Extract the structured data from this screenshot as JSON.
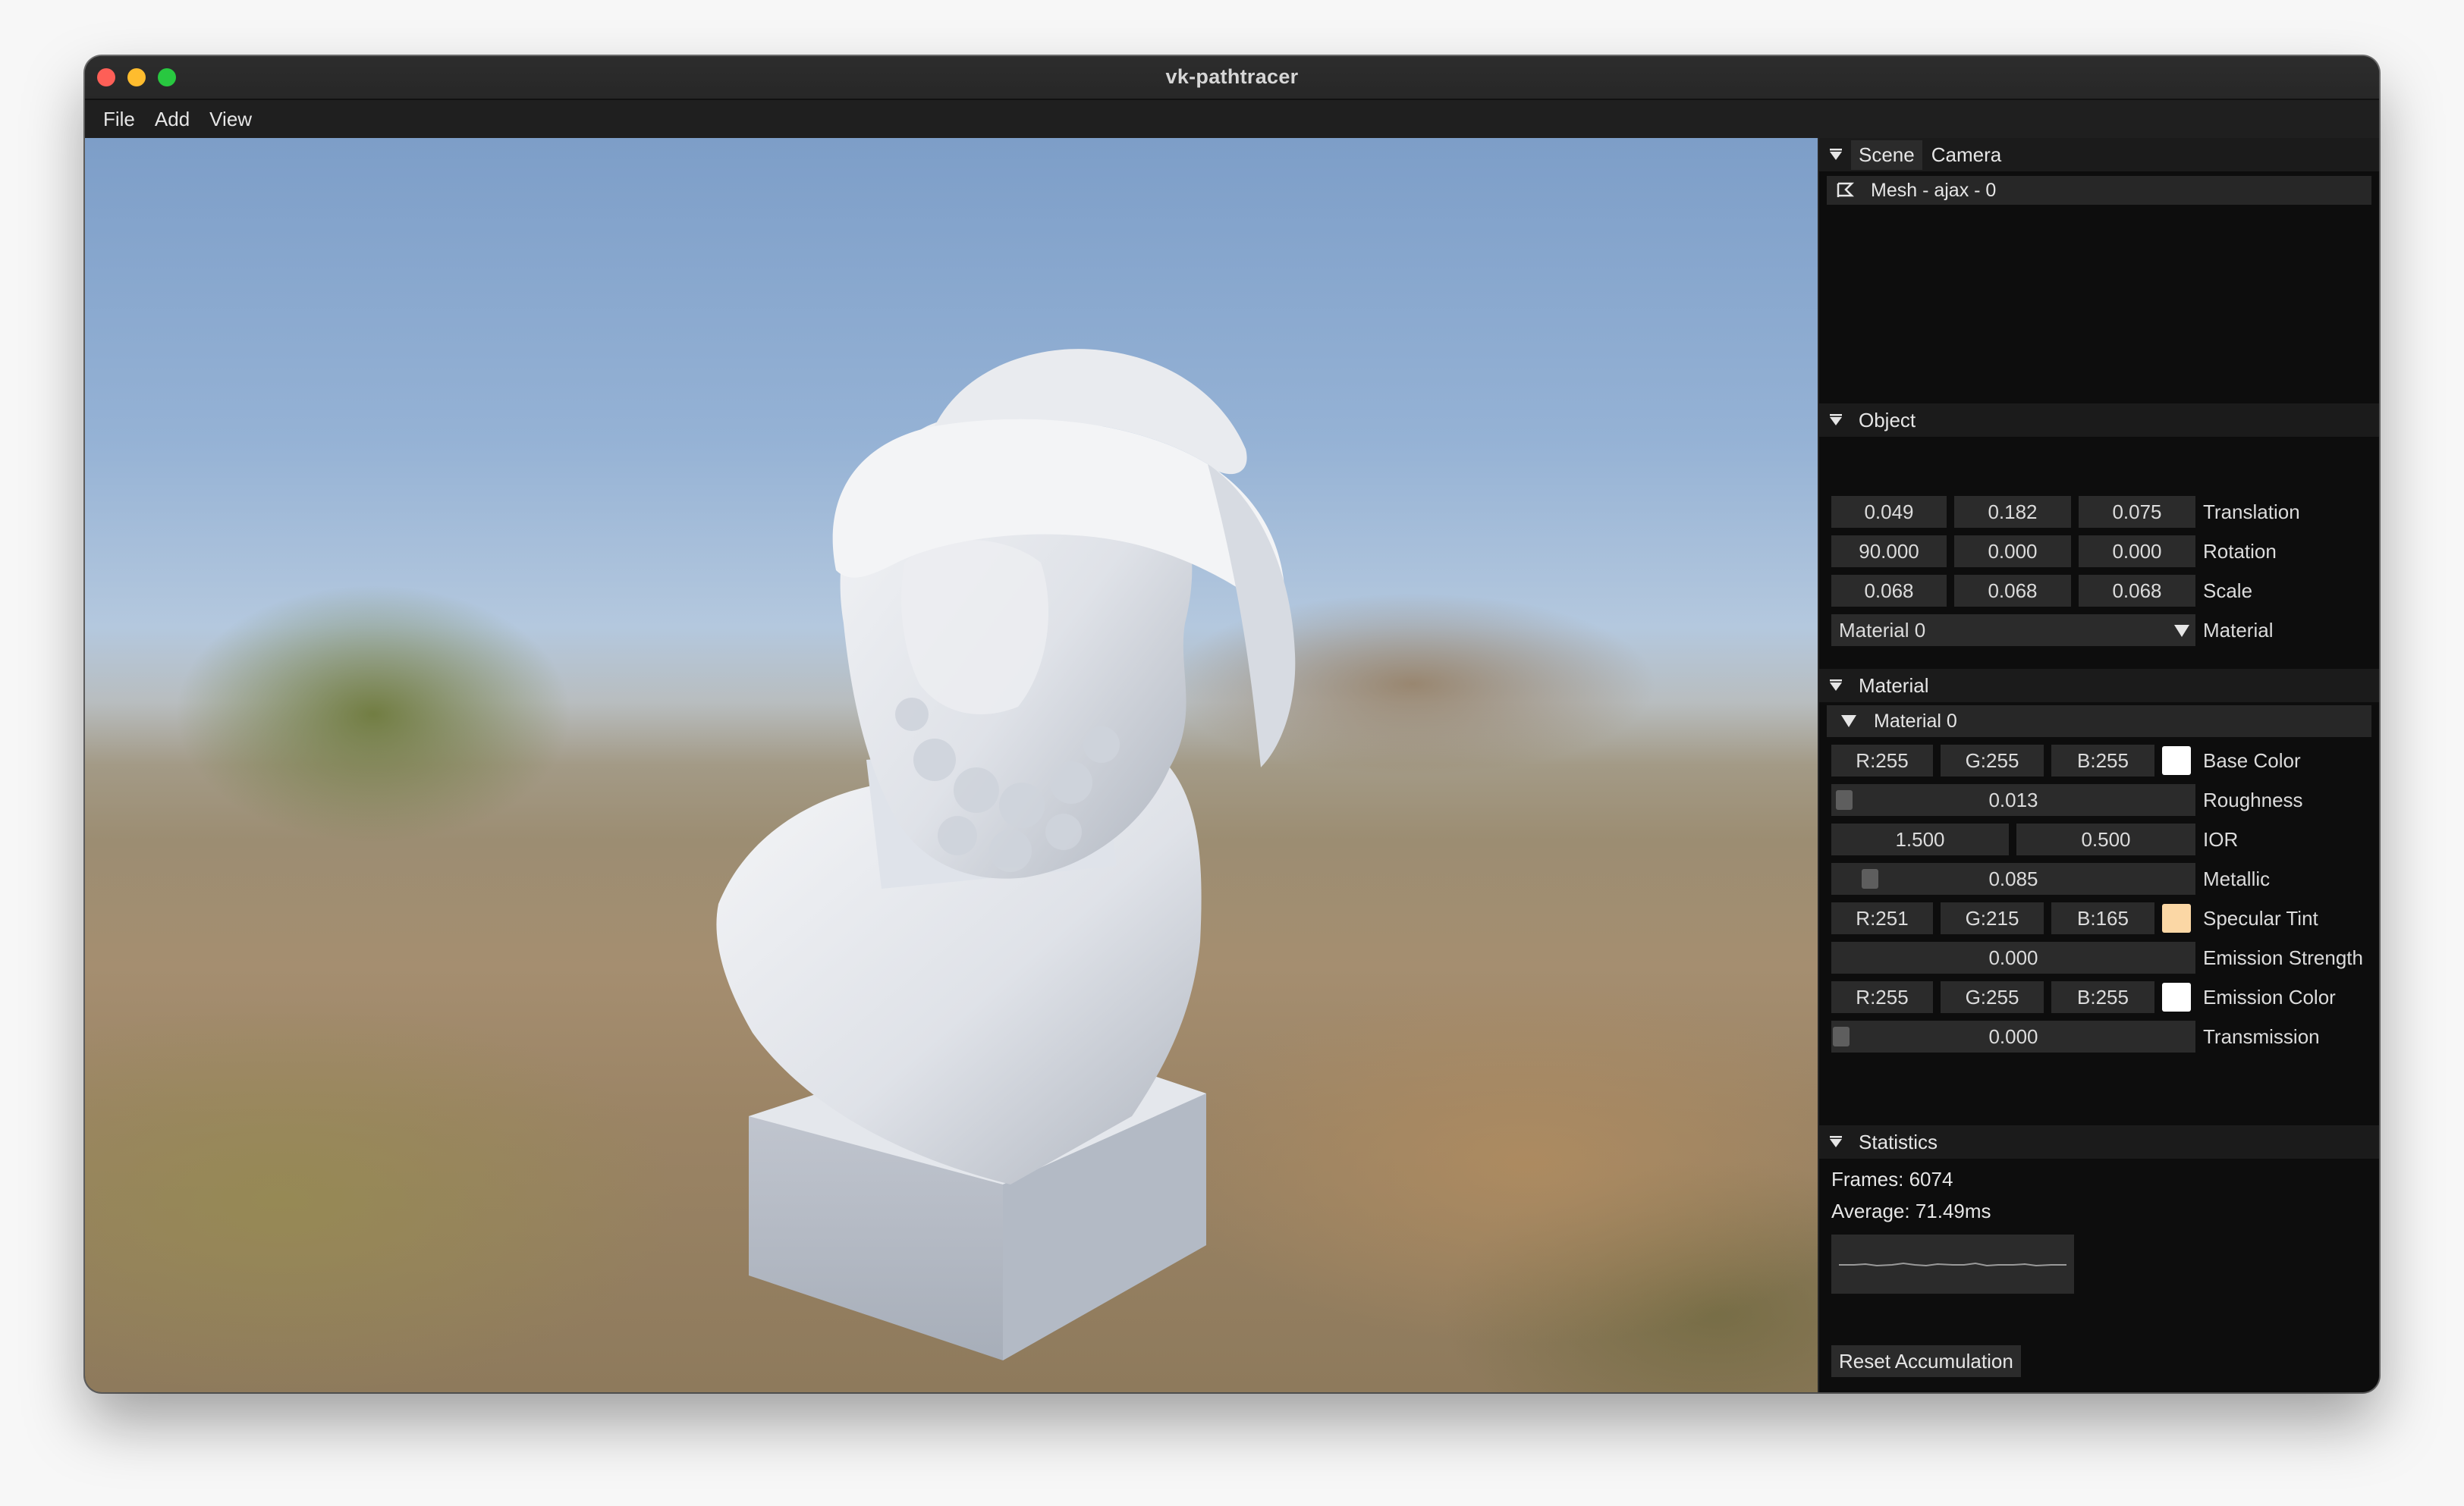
{
  "window": {
    "title": "vk-pathtracer"
  },
  "menu": [
    "File",
    "Add",
    "View"
  ],
  "scene": {
    "tabs": [
      "Scene",
      "Camera"
    ],
    "tree_item": "Mesh - ajax - 0"
  },
  "object": {
    "header": "Object",
    "translation": {
      "values": [
        "0.049",
        "0.182",
        "0.075"
      ],
      "label": "Translation"
    },
    "rotation": {
      "values": [
        "90.000",
        "0.000",
        "0.000"
      ],
      "label": "Rotation"
    },
    "scale": {
      "values": [
        "0.068",
        "0.068",
        "0.068"
      ],
      "label": "Scale"
    },
    "material": {
      "value": "Material 0",
      "label": "Material"
    }
  },
  "material": {
    "header": "Material",
    "name": "Material 0",
    "base_color": {
      "r": "R:255",
      "g": "G:255",
      "b": "B:255",
      "label": "Base Color",
      "swatch": "#ffffff"
    },
    "roughness": {
      "value": "0.013",
      "label": "Roughness"
    },
    "ior": {
      "values": [
        "1.500",
        "0.500"
      ],
      "label": "IOR"
    },
    "metallic": {
      "value": "0.085",
      "label": "Metallic"
    },
    "specular_tint": {
      "r": "R:251",
      "g": "G:215",
      "b": "B:165",
      "label": "Specular Tint",
      "swatch": "#fbd7a5"
    },
    "emission_strength": {
      "value": "0.000",
      "label": "Emission Strength"
    },
    "emission_color": {
      "r": "R:255",
      "g": "G:255",
      "b": "B:255",
      "label": "Emission Color",
      "swatch": "#ffffff"
    },
    "transmission": {
      "value": "0.000",
      "label": "Transmission"
    }
  },
  "statistics": {
    "header": "Statistics",
    "frames": "Frames: 6074",
    "average": "Average:  71.49ms",
    "reset_label": "Reset Accumulation"
  }
}
